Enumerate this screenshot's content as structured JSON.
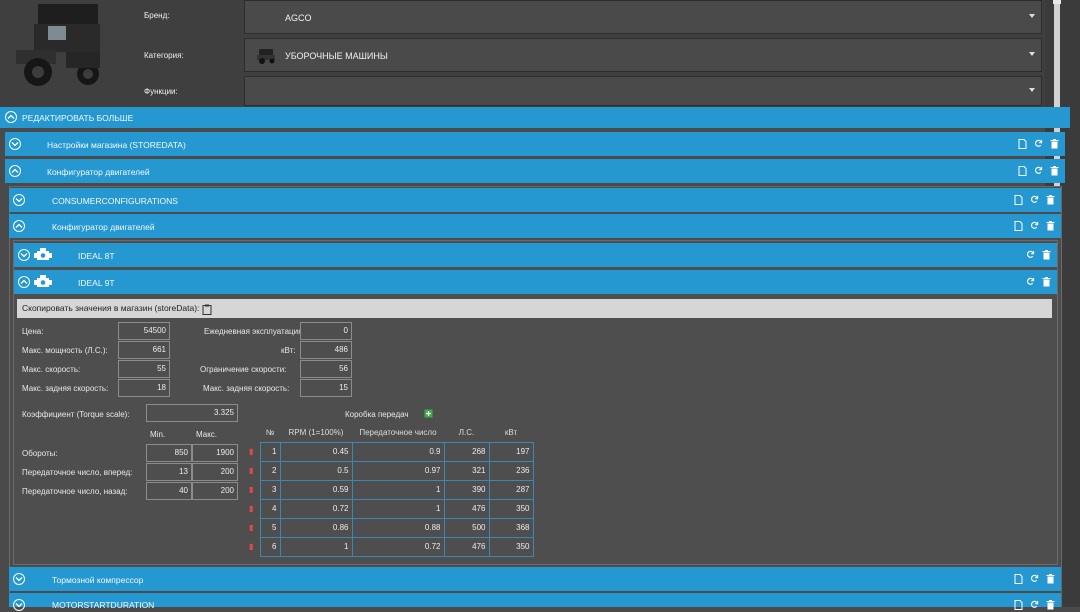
{
  "header": {
    "fields": [
      {
        "label": "Бренд:",
        "value": "AGCO"
      },
      {
        "label": "Категория:",
        "value": "УБОРОЧНЫЕ МАШИНЫ"
      },
      {
        "label": "Функции:",
        "value": ""
      }
    ]
  },
  "edit_more": "РЕДАКТИРОВАТЬ БОЛЬШЕ",
  "sections": {
    "store_settings": "Настройки магазина (STOREDATA)",
    "engine_configurator": "Конфигуратор двигателей",
    "consumer": "CONSUMERCONFIGURATIONS",
    "engine_configurator_inner": "Конфигуратор двигателей",
    "ideal_8t": "IDEAL 8T",
    "ideal_9t": "IDEAL 9T",
    "brake": "Тормозной компрессор",
    "motorstart": "MOTORSTARTDURATION"
  },
  "copy_label": "Скопировать значения в магазин (storeData):",
  "form": {
    "price": {
      "label": "Цена:",
      "value": "54500"
    },
    "max_power": {
      "label": "Макс. мощность (Л.С.):",
      "value": "661"
    },
    "max_speed": {
      "label": "Макс. скорость:",
      "value": "55"
    },
    "max_rev_speed": {
      "label": "Макс. задняя скорость:",
      "value": "18"
    },
    "daily_upkeep": {
      "label": "Ежедневная эксплуатация:",
      "value": "0"
    },
    "kw": {
      "label": "кВт:",
      "value": "486"
    },
    "speed_limit": {
      "label": "Ограничение скорости:",
      "value": "56"
    },
    "max_rev_speed2": {
      "label": "Макс. задняя скорость:",
      "value": "15"
    },
    "torque_scale": {
      "label": "Коэффициент (Torque scale):",
      "value": "3.325"
    },
    "min_label": "Min.",
    "max_label": "Макс.",
    "rpm": {
      "label": "Обороты:",
      "min": "850",
      "max": "1900"
    },
    "gear_fwd": {
      "label": "Передаточное число, вперед:",
      "min": "13",
      "max": "200"
    },
    "gear_rev": {
      "label": "Передаточное число, назад:",
      "min": "40",
      "max": "200"
    },
    "gearbox_label": "Коробка передач"
  },
  "gear_table": {
    "headers": [
      "№",
      "RPM (1=100%)",
      "Передаточное число",
      "Л.С.",
      "кВт"
    ],
    "rows": [
      [
        "1",
        "0.45",
        "0.9",
        "268",
        "197"
      ],
      [
        "2",
        "0.5",
        "0.97",
        "321",
        "236"
      ],
      [
        "3",
        "0.59",
        "1",
        "390",
        "287"
      ],
      [
        "4",
        "0.72",
        "1",
        "476",
        "350"
      ],
      [
        "5",
        "0.86",
        "0.88",
        "500",
        "368"
      ],
      [
        "6",
        "1",
        "0.72",
        "476",
        "350"
      ]
    ]
  },
  "colors": {
    "accent": "#2598d1",
    "delete": "#e24a4a",
    "add": "#3fae49"
  }
}
